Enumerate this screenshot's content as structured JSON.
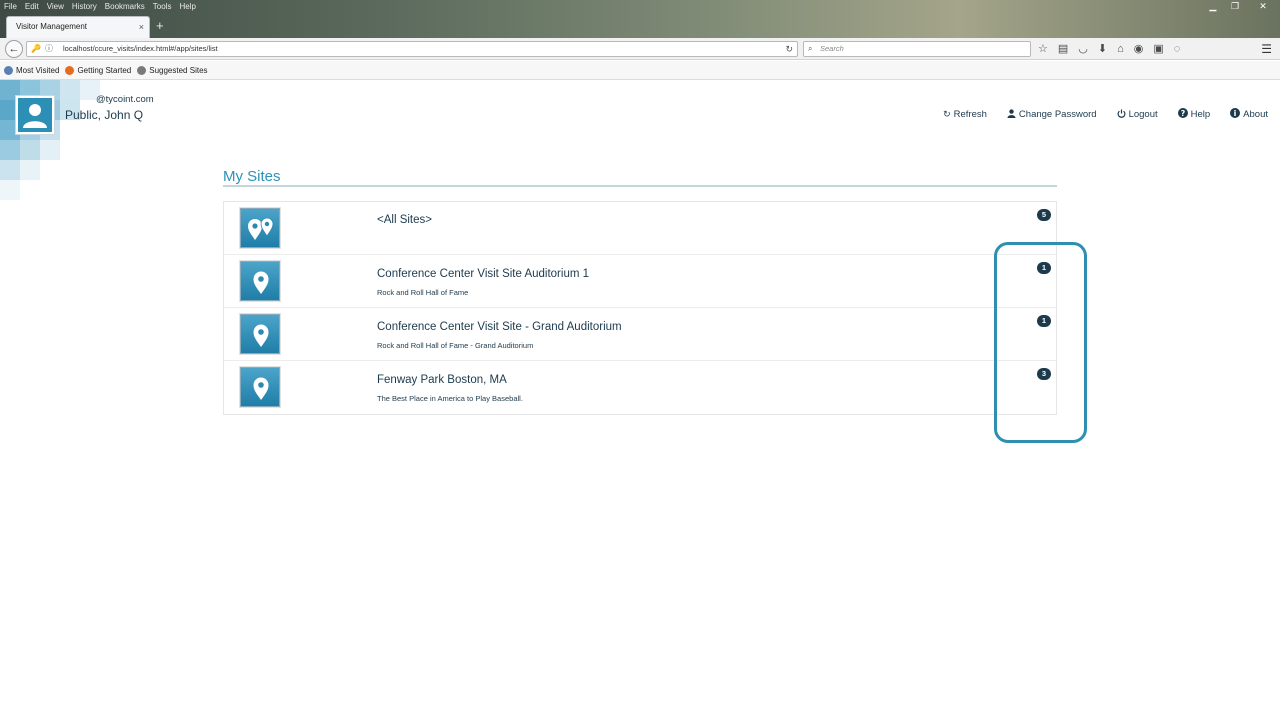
{
  "browser": {
    "menu": [
      "File",
      "Edit",
      "View",
      "History",
      "Bookmarks",
      "Tools",
      "Help"
    ],
    "tab_title": "Visitor Management",
    "tab_close": "×",
    "new_tab": "+",
    "url": "localhost/ccure_visits/index.html#/app/sites/list",
    "search_placeholder": "Search",
    "bookmarks": [
      {
        "label": "Most Visited",
        "color": "#5a7fb5"
      },
      {
        "label": "Getting Started",
        "color": "#e86a1e"
      },
      {
        "label": "Suggested Sites",
        "color": "#7a7a7a"
      }
    ]
  },
  "user": {
    "email": "@tycoint.com",
    "name": "Public, John Q"
  },
  "actions": [
    {
      "label": "Refresh",
      "icon": "refresh-icon",
      "glyph": "↻"
    },
    {
      "label": "Change Password",
      "icon": "user-icon",
      "glyph": "👤"
    },
    {
      "label": "Logout",
      "icon": "power-icon",
      "glyph": "⏻"
    },
    {
      "label": "Help",
      "icon": "help-icon",
      "glyph": "?"
    },
    {
      "label": "About",
      "icon": "info-icon",
      "glyph": "i"
    }
  ],
  "main": {
    "title": "My Sites",
    "sites": [
      {
        "name": "<All Sites>",
        "description": "",
        "count": "5",
        "icon": "multi-pin-icon"
      },
      {
        "name": "Conference Center Visit Site Auditorium 1",
        "description": "Rock and Roll Hall of Fame",
        "count": "1",
        "icon": "pin-icon"
      },
      {
        "name": "Conference Center Visit Site - Grand Auditorium",
        "description": "Rock and Roll Hall of Fame - Grand Auditorium",
        "count": "1",
        "icon": "pin-icon"
      },
      {
        "name": "Fenway Park Boston, MA",
        "description": "The Best Place in America to Play Baseball.",
        "count": "3",
        "icon": "pin-icon"
      }
    ]
  },
  "colors": {
    "accent": "#2b93b6",
    "text": "#1d3a4d",
    "highlight": "#2e8fb0"
  }
}
